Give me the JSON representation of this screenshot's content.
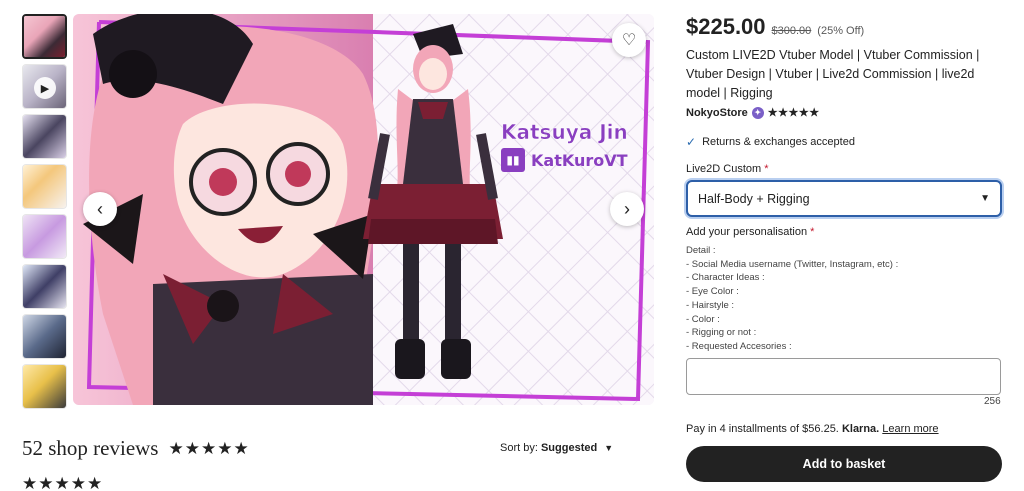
{
  "listing": {
    "price": "$225.00",
    "original_price": "$300.00",
    "discount": "(25% Off)",
    "title": "Custom LIVE2D Vtuber Model | Vtuber Commission | Vtuber Design | Vtuber | Live2d Commission | live2d model | Rigging",
    "shop_name": "NokyoStore",
    "shop_stars": "★★★★★",
    "returns": "Returns & exchanges accepted"
  },
  "variation": {
    "label": "Live2D Custom",
    "required_mark": "*",
    "selected": "Half-Body + Rigging"
  },
  "personalisation": {
    "label": "Add your personalisation",
    "required_mark": "*",
    "details": [
      "Detail :",
      "- Social Media username (Twitter, Instagram, etc) :",
      "- Character Ideas :",
      "- Eye Color :",
      "- Hairstyle :",
      "- Color :",
      "- Rigging or not :",
      "- Requested Accesories :"
    ],
    "char_count": "256"
  },
  "payment": {
    "prefix": "Pay in 4 installments of $56.25.",
    "provider": "Klarna.",
    "link": "Learn more"
  },
  "cta": {
    "add_to_basket": "Add to basket"
  },
  "gallery": {
    "watermark_name": "Katsuya Jin",
    "watermark_handle": "KatKuroVT"
  },
  "reviews": {
    "title": "52 shop reviews",
    "stars": "★★★★★",
    "sort_prefix": "Sort by:",
    "sort_value": "Suggested",
    "first_review_stars": "★★★★★"
  },
  "icons": {
    "heart": "heart-icon",
    "prev": "chevron-left-icon",
    "next": "chevron-right-icon",
    "check": "check-icon",
    "caret": "caret-down-icon",
    "play": "play-icon"
  },
  "colors": {
    "accent_blue": "#2d5fa8",
    "button_dark": "#222222",
    "frame_magenta": "#c43fd6",
    "required_red": "#c4182d"
  }
}
